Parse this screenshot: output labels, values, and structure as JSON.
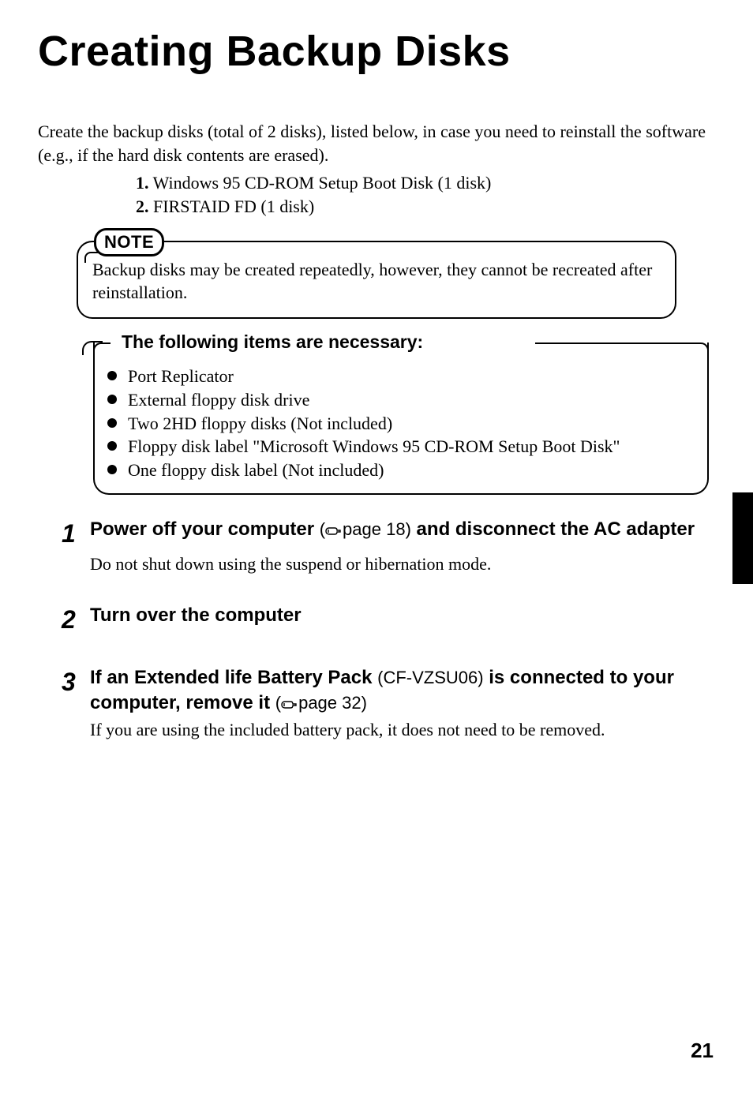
{
  "title": "Creating Backup Disks",
  "intro": "Create the backup disks (total of 2 disks), listed below, in case you need to reinstall the software (e.g., if the hard disk contents are erased).",
  "list": {
    "n1": "1.",
    "i1": " Windows 95 CD-ROM Setup Boot Disk (1 disk)",
    "n2": "2.",
    "i2": " FIRSTAID FD (1 disk)"
  },
  "note": {
    "label": "NOTE",
    "text": "Backup disks may be created repeatedly, however, they cannot be recreated after reinstallation."
  },
  "items": {
    "title": "The following items are necessary:",
    "b1": "Port Replicator",
    "b2": "External floppy disk drive",
    "b3": "Two 2HD floppy disks (Not included)",
    "b4": "Floppy disk label \"Microsoft Windows 95 CD-ROM Setup Boot Disk\"",
    "b5": "One floppy disk label (Not included)"
  },
  "steps": {
    "s1": {
      "num": "1",
      "h_a": "Power off your computer ",
      "ref": "page 18",
      "h_b": " and disconnect the AC adapter",
      "body": "Do not shut down using the suspend or hibernation mode."
    },
    "s2": {
      "num": "2",
      "h_a": "Turn over the computer"
    },
    "s3": {
      "num": "3",
      "h_a": "If an Extended life Battery Pack ",
      "thin": "(CF-VZSU06)",
      "h_b": " is connected to your computer, remove it ",
      "ref": "page 32",
      "body": "If you are using the included battery pack, it does not need to be removed."
    }
  },
  "page_number": "21"
}
